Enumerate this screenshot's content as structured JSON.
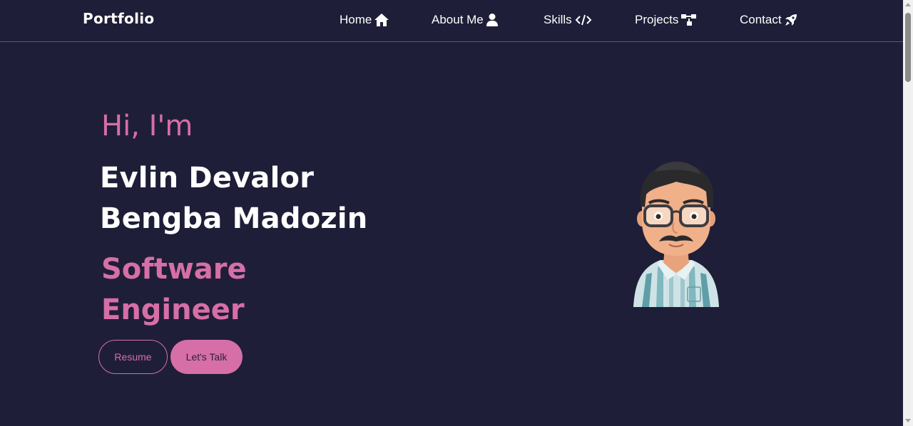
{
  "nav": {
    "brand": "Portfolio",
    "links": [
      {
        "label": "Home",
        "icon": "home-icon"
      },
      {
        "label": "About Me",
        "icon": "user-icon"
      },
      {
        "label": "Skills",
        "icon": "code-icon"
      },
      {
        "label": "Projects",
        "icon": "sitemap-icon"
      },
      {
        "label": "Contact",
        "icon": "rocket-icon"
      }
    ]
  },
  "hero": {
    "greeting": "Hi, I'm",
    "name_line1": "Evlin Devalor",
    "name_line2": "Bengba Madozin",
    "role_line1": "Software",
    "role_line2": "Engineer",
    "resume_label": "Resume",
    "talk_label": "Let's Talk",
    "avatar": "memoji-avatar"
  },
  "colors": {
    "background": "#1f1e38",
    "accent": "#d66fa7",
    "text": "#ffffff"
  }
}
